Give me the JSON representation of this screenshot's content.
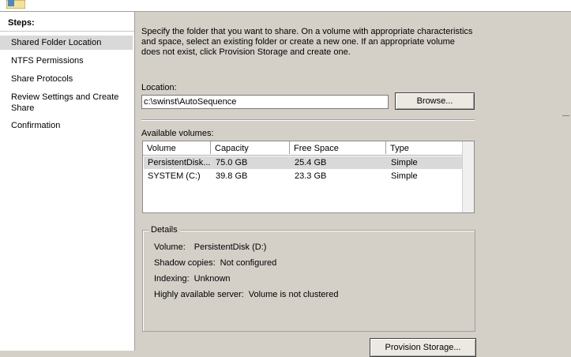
{
  "steps": {
    "header": "Steps:",
    "items": [
      {
        "label": "Shared Folder Location",
        "active": true
      },
      {
        "label": "NTFS Permissions"
      },
      {
        "label": "Share Protocols"
      },
      {
        "label": "Review Settings and Create Share"
      },
      {
        "label": "Confirmation"
      }
    ]
  },
  "main": {
    "intro": "Specify the folder that you want to share. On a volume with appropriate characteristics and space, select an existing folder or create a new one. If an appropriate volume does not exist, click Provision Storage and create one.",
    "location_label": "Location:",
    "location_value": "c:\\swinst\\AutoSequence",
    "browse_label": "Browse...",
    "volumes_label": "Available volumes:",
    "columns": [
      "Volume",
      "Capacity",
      "Free Space",
      "Type"
    ],
    "volumes": [
      {
        "volume": "PersistentDisk...",
        "capacity": "75.0 GB",
        "free": "25.4 GB",
        "type": "Simple",
        "selected": true
      },
      {
        "volume": "SYSTEM (C:)",
        "capacity": "39.8 GB",
        "free": "23.3 GB",
        "type": "Simple"
      }
    ],
    "details": {
      "title": "Details",
      "volume_label": "Volume:",
      "volume_value": "PersistentDisk (D:)",
      "shadow_label": "Shadow copies:",
      "shadow_value": "Not configured",
      "indexing_label": "Indexing:",
      "indexing_value": "Unknown",
      "ha_label": "Highly available server:",
      "ha_value": "Volume is not clustered"
    },
    "provision_label": "Provision Storage..."
  }
}
